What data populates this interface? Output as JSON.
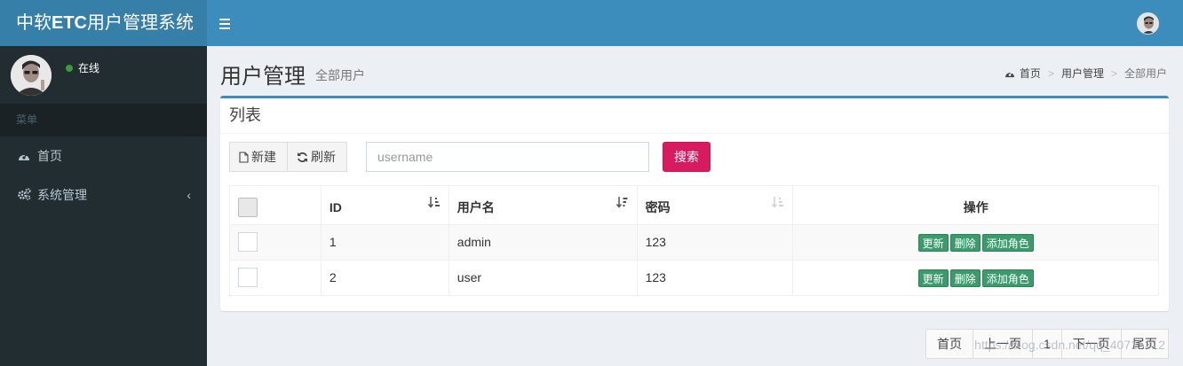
{
  "app": {
    "title_prefix": "中软",
    "title_bold": "ETC",
    "title_suffix": "用户管理系统"
  },
  "sidebar": {
    "status": "在线",
    "menu_header": "菜单",
    "items": [
      {
        "label": "首页"
      },
      {
        "label": "系统管理"
      }
    ]
  },
  "header": {
    "title": "用户管理",
    "subtitle": "全部用户",
    "breadcrumb": [
      "首页",
      "用户管理",
      "全部用户"
    ]
  },
  "box": {
    "title": "列表"
  },
  "toolbar": {
    "new_label": "新建",
    "refresh_label": "刷新",
    "search_label": "搜索"
  },
  "search": {
    "placeholder": "username",
    "value": ""
  },
  "table": {
    "headers": [
      "ID",
      "用户名",
      "密码",
      "操作"
    ],
    "rows": [
      {
        "id": "1",
        "username": "admin",
        "password": "123"
      },
      {
        "id": "2",
        "username": "user",
        "password": "123"
      }
    ],
    "actions": [
      "更新",
      "删除",
      "添加角色"
    ]
  },
  "pagination": [
    "首页",
    "上一页",
    "1",
    "下一页",
    "尾页"
  ],
  "watermark": "https://blog.csdn.net/qq_40715312",
  "colors": {
    "header": "#3c8dbc",
    "logo": "#367fa9",
    "sidebar": "#222d32",
    "search_btn": "#d81b60",
    "action_btn": "#3b9b6d",
    "online": "#3c9a3f"
  }
}
